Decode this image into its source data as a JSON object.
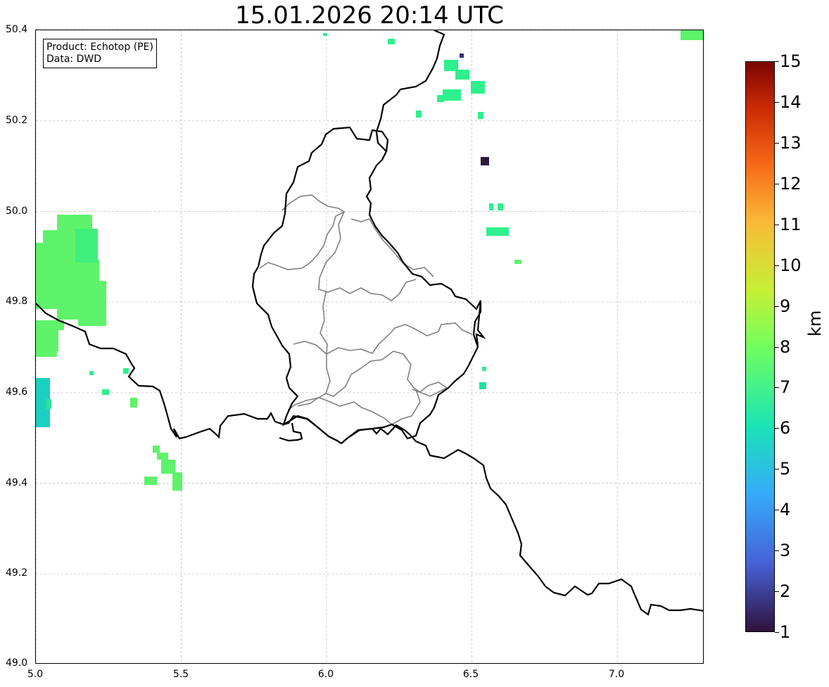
{
  "title": "15.01.2026 20:14 UTC",
  "info_box": {
    "product": "Product: Echotop (PE)",
    "data": "Data: DWD"
  },
  "axes": {
    "x_ticks": [
      "5.0",
      "5.5",
      "6.0",
      "6.5",
      "7.0"
    ],
    "y_ticks": [
      "50.4",
      "50.2",
      "50.0",
      "49.8",
      "49.6",
      "49.4",
      "49.2",
      "49.0"
    ],
    "x_range": [
      5.0,
      7.3
    ],
    "y_range": [
      49.0,
      50.4
    ],
    "grid": true
  },
  "colorbar": {
    "label": "km",
    "ticks": [
      "15",
      "14",
      "13",
      "12",
      "11",
      "10",
      "9",
      "8",
      "7",
      "6",
      "5",
      "4",
      "3",
      "2",
      "1"
    ],
    "range": [
      1,
      15
    ],
    "colormap": "turbo"
  },
  "colors": {
    "country_border": "#000000",
    "district_border": "#808080",
    "grid": "#c0c0c0",
    "echo_green": "#5ef36a",
    "echo_teal": "#2ef08c",
    "echo_cyan": "#1bd0c0",
    "echo_dark": "#2b1a3e"
  }
}
